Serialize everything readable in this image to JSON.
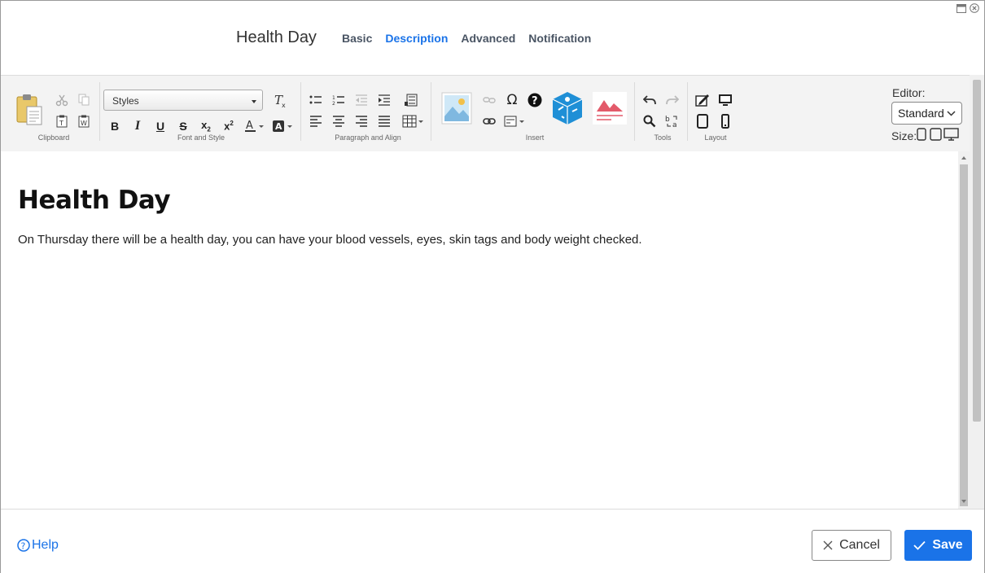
{
  "header": {
    "title": "Health Day",
    "tabs": [
      {
        "label": "Basic"
      },
      {
        "label": "Description"
      },
      {
        "label": "Advanced"
      },
      {
        "label": "Notification"
      }
    ]
  },
  "toolbar": {
    "groups": {
      "clipboard": "Clipboard",
      "font_style": "Font and Style",
      "paragraph": "Paragraph and Align",
      "insert": "Insert",
      "tools": "Tools",
      "layout": "Layout"
    },
    "styles_placeholder": "Styles",
    "editor_label": "Editor:",
    "editor_value": "Standard",
    "size_label": "Size:"
  },
  "content": {
    "heading": "Health Day",
    "body": "On Thursday there will be a health day, you can have your blood vessels, eyes, skin tags and body weight checked."
  },
  "footer": {
    "help": "Help",
    "cancel": "Cancel",
    "save": "Save"
  },
  "colors": {
    "accent": "#1a73e8",
    "toolbar_bg": "#f3f3f3"
  }
}
